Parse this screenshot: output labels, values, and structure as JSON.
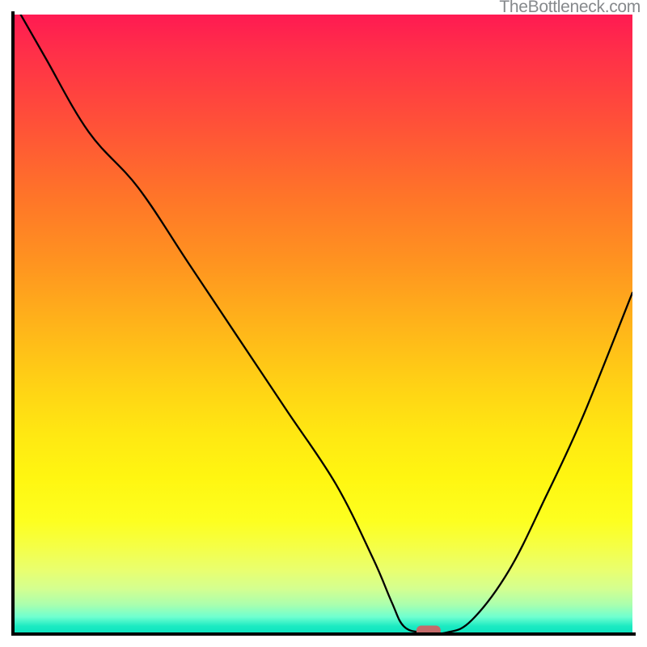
{
  "watermark": "TheBottleneck.com",
  "chart_data": {
    "type": "line",
    "title": "",
    "xlabel": "",
    "ylabel": "",
    "xlim": [
      0,
      100
    ],
    "ylim": [
      0,
      100
    ],
    "grid": false,
    "legend": false,
    "series": [
      {
        "name": "bottleneck-curve",
        "x": [
          1,
          5,
          12,
          20,
          28,
          36,
          44,
          52,
          58,
          61,
          63,
          66,
          70,
          74,
          80,
          86,
          92,
          100
        ],
        "y": [
          100,
          93,
          81,
          72,
          60,
          48,
          36,
          24,
          12,
          5,
          1,
          0,
          0,
          2,
          10,
          22,
          35,
          55
        ]
      }
    ],
    "marker": {
      "name": "optimal-point",
      "x": 67,
      "y": 0,
      "color": "#c46a6a",
      "shape": "pill"
    },
    "gradient_stops": [
      {
        "pos": 0.0,
        "color": "#ff1a52"
      },
      {
        "pos": 0.5,
        "color": "#ffb31a"
      },
      {
        "pos": 0.82,
        "color": "#fdff20"
      },
      {
        "pos": 1.0,
        "color": "#0fe5c0"
      }
    ]
  }
}
